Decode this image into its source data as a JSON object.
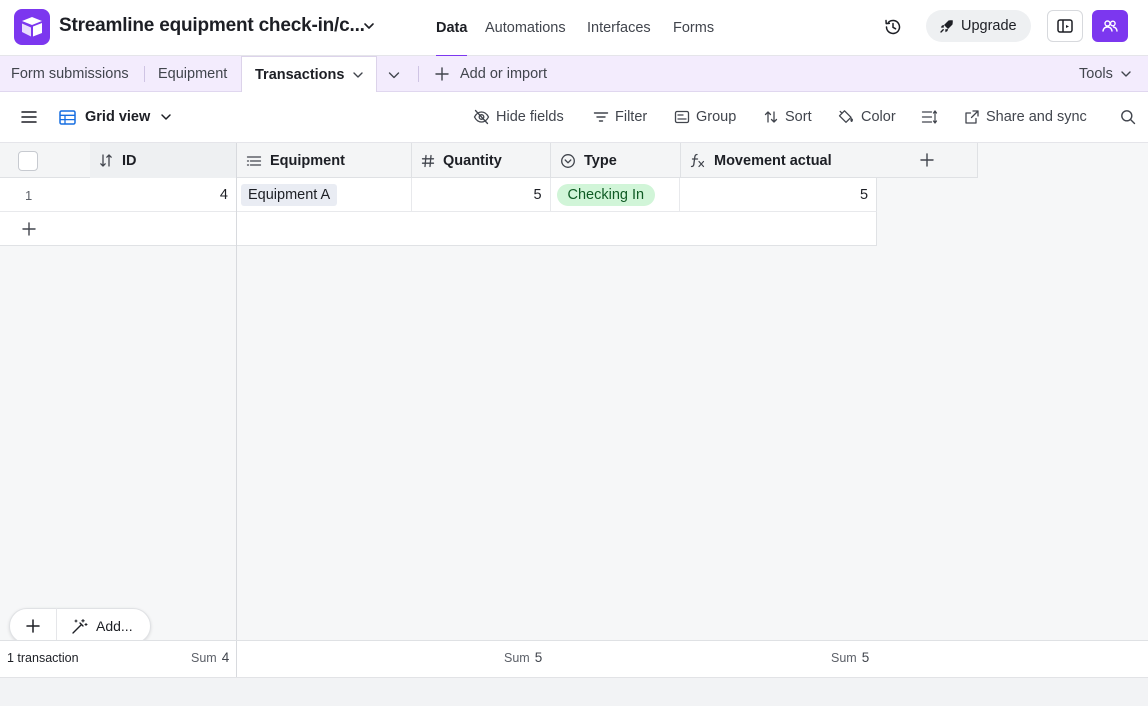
{
  "app": {
    "base_title": "Streamline equipment check-in/c..."
  },
  "top_nav": [
    "Data",
    "Automations",
    "Interfaces",
    "Forms"
  ],
  "top_actions": {
    "upgrade_label": "Upgrade"
  },
  "tabs": {
    "items": [
      {
        "label": "Form submissions"
      },
      {
        "label": "Equipment"
      },
      {
        "label": "Transactions",
        "active": true
      }
    ],
    "add_import_label": "Add or import",
    "tools_label": "Tools"
  },
  "view": {
    "name": "Grid view",
    "toolbar": {
      "hide_fields": "Hide fields",
      "filter": "Filter",
      "group": "Group",
      "sort": "Sort",
      "color": "Color",
      "share_sync": "Share and sync"
    }
  },
  "grid": {
    "columns": [
      {
        "name": "ID",
        "icon": "sort-icon"
      },
      {
        "name": "Equipment",
        "icon": "linked-record-icon"
      },
      {
        "name": "Quantity",
        "icon": "number-icon"
      },
      {
        "name": "Type",
        "icon": "single-select-icon"
      },
      {
        "name": "Movement actual",
        "icon": "formula-icon"
      }
    ],
    "rows": [
      {
        "row_number": "1",
        "id": "4",
        "equipment": "Equipment A",
        "quantity": "5",
        "type": "Checking In",
        "movement_actual": "5"
      }
    ],
    "add_menu_label": "Add...",
    "summary": {
      "count_label": "1 transaction",
      "sum_label": "Sum",
      "id_sum": "4",
      "quantity_sum": "5",
      "movement_sum": "5"
    }
  },
  "colors": {
    "brand": "#7c37ef",
    "tabs_background": "#f3ecfd",
    "type_pill_background": "#d1f5d8",
    "type_pill_text": "#0f5b24"
  }
}
